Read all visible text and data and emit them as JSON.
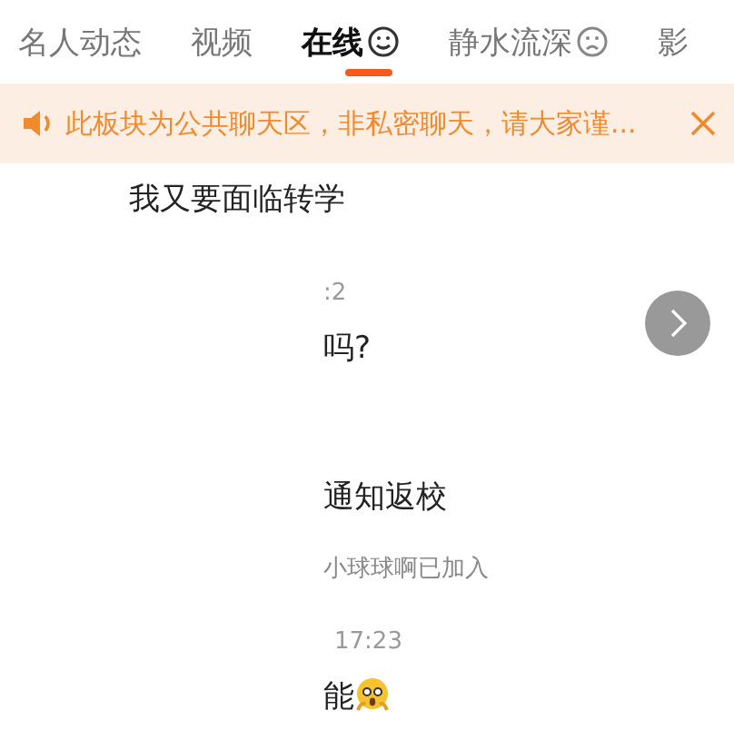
{
  "tabs": [
    {
      "label": "名人动态",
      "selected": false
    },
    {
      "label": "视频",
      "selected": false
    },
    {
      "label": "在线",
      "selected": true
    },
    {
      "label": "静水流深",
      "selected": false
    },
    {
      "label": "影",
      "selected": false
    }
  ],
  "notice": {
    "text": "此板块为公共聊天区，非私密聊天，请大家谨..."
  },
  "messages": [
    {
      "kind": "text",
      "text": "我又要面临转学"
    },
    {
      "kind": "time",
      "text": ":2"
    },
    {
      "kind": "text",
      "text": "吗?"
    },
    {
      "kind": "text",
      "text": "通知返校"
    },
    {
      "kind": "system",
      "text": "小球球啊已加入"
    },
    {
      "kind": "time",
      "text": "17:23"
    },
    {
      "kind": "text",
      "text": "能"
    }
  ]
}
